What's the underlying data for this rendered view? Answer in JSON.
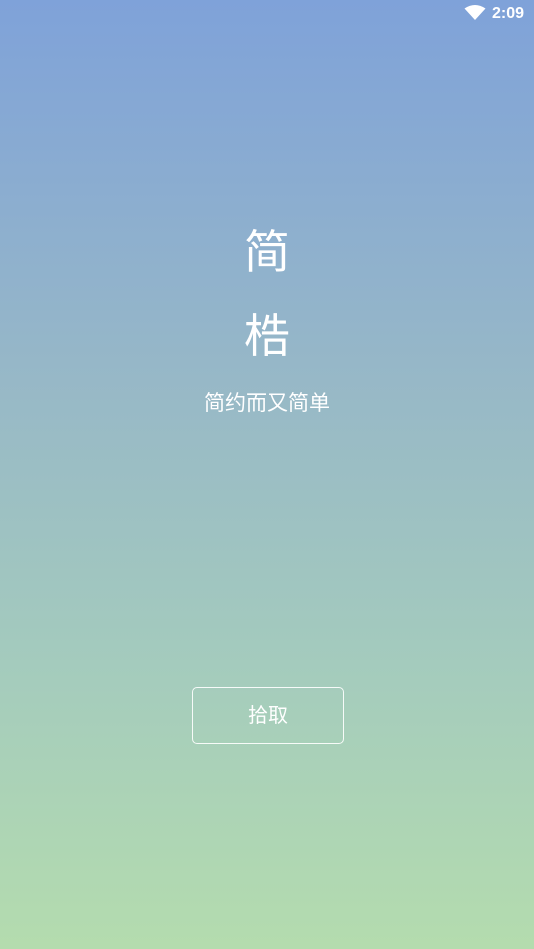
{
  "status_bar": {
    "time": "2:09",
    "wifi_icon": "wifi-icon"
  },
  "app": {
    "title_line_1": "简",
    "title_line_2": "梏",
    "subtitle": "简约而又简单",
    "pick_button_label": "拾取"
  },
  "colors": {
    "gradient_top": "#7fa2d9",
    "gradient_bottom": "#b4dcae",
    "text": "#ffffff"
  }
}
